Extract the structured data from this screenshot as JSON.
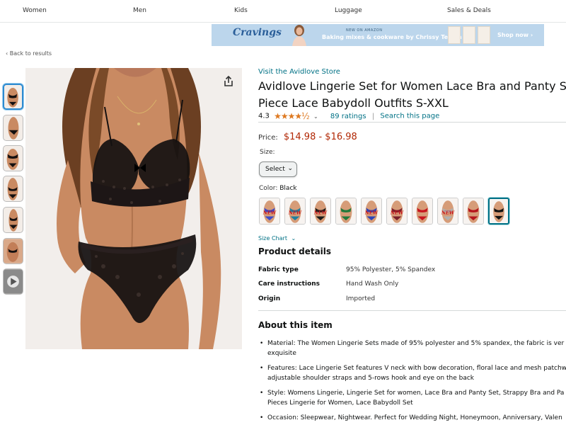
{
  "nav": {
    "items": [
      "Women",
      "Men",
      "Kids",
      "Luggage",
      "Sales & Deals"
    ]
  },
  "banner": {
    "logo": "Cravings",
    "small_text": "NEW ON AMAZON",
    "headline": "Baking mixes & cookware by Chrissy Teigen",
    "cta": "Shop now ›"
  },
  "back_link": "‹ Back to results",
  "store_link": "Visit the Avidlove Store",
  "title_line1": "Avidlove Lingerie Set for Women Lace Bra and Panty Set",
  "title_line2": "Piece Lace Babydoll Outfits S-XXL",
  "rating": {
    "value": "4.3",
    "stars": "★★★★½",
    "count": "89 ratings",
    "search": "Search this page",
    "filled_fraction": 0.86
  },
  "price": {
    "label": "Price:",
    "range": "$14.98 - $16.98"
  },
  "size": {
    "label": "Size:",
    "selected": "Select"
  },
  "color": {
    "label": "Color:",
    "selected": "Black"
  },
  "swatches": [
    {
      "color": "#3b49c9",
      "badge": "NEW"
    },
    {
      "color": "#1e7fa0",
      "badge": "NEW"
    },
    {
      "color": "#1a1a1a",
      "badge": "NEW"
    },
    {
      "color": "#1f7a3c",
      "badge": ""
    },
    {
      "color": "#2c44b8",
      "badge": "NEW"
    },
    {
      "color": "#7a1f2a",
      "badge": "NEW"
    },
    {
      "color": "#c8141e",
      "badge": ""
    },
    {
      "color": "#b0b0b0",
      "badge": "NEW"
    },
    {
      "color": "#b5141c",
      "badge": ""
    },
    {
      "color": "#111111",
      "badge": ""
    }
  ],
  "size_chart": "Size Chart",
  "product_details": {
    "heading": "Product details",
    "rows": [
      {
        "key": "Fabric type",
        "value": "95% Polyester, 5% Spandex"
      },
      {
        "key": "Care instructions",
        "value": "Hand Wash Only"
      },
      {
        "key": "Origin",
        "value": "Imported"
      }
    ]
  },
  "about": {
    "heading": "About this item",
    "bullets": [
      {
        "line1": "Material: The Women Lingerie Sets made of 95% polyester and 5% spandex, the fabric is ver",
        "line2": "exquisite"
      },
      {
        "line1": "Features: Lace Lingerie Set features V neck with bow decoration, floral lace and mesh patchw",
        "line2": "adjustable shoulder straps and 5-rows hook and eye on the back"
      },
      {
        "line1": "Style: Womens Lingerie, Lingerie Set for women, Lace Bra and Panty Set, Strappy Bra and Pa",
        "line2": "Pieces Lingerie for Women, Lace Babydoll Set"
      },
      {
        "line1": "Occasion: Sleepwear, Nightwear. Perfect for Wedding Night, Honeymoon, Anniversary, Valen",
        "line2": ""
      }
    ]
  },
  "colors": {
    "link": "#007185",
    "price": "#b12704",
    "star": "#de7921",
    "skin": "#c98a62",
    "lace": "#141010"
  }
}
